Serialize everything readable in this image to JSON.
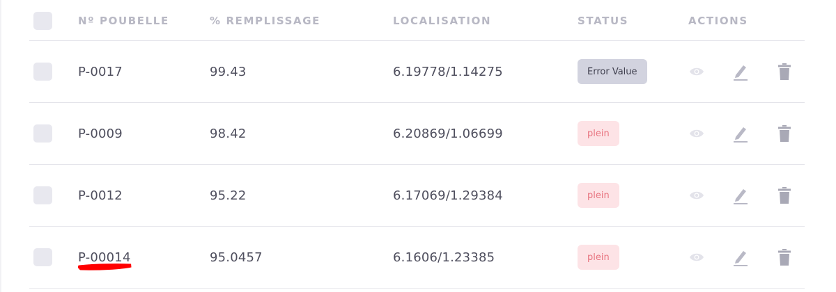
{
  "table": {
    "headers": {
      "id": "Nº POUBELLE",
      "fill": "% REMPLISSAGE",
      "location": "LOCALISATION",
      "status": "STATUS",
      "actions": "ACTIONS"
    },
    "rows": [
      {
        "id": "P-0017",
        "fill": "99.43",
        "location": "6.19778/1.14275",
        "status": "Error Value",
        "status_type": "error"
      },
      {
        "id": "P-0009",
        "fill": "98.42",
        "location": "6.20869/1.06699",
        "status": "plein",
        "status_type": "plein"
      },
      {
        "id": "P-0012",
        "fill": "95.22",
        "location": "6.17069/1.29384",
        "status": "plein",
        "status_type": "plein"
      },
      {
        "id": "P-00014",
        "fill": "95.0457",
        "location": "6.1606/1.23385",
        "status": "plein",
        "status_type": "plein"
      }
    ],
    "row_actions": [
      "eye-icon",
      "pencil-icon",
      "trash-icon"
    ]
  },
  "colors": {
    "header_text": "#b8b8c4",
    "error_badge_bg": "#d2d3df",
    "plein_badge_bg": "#fde3e6",
    "plein_badge_text": "#e8737f",
    "annotation_underline": "#ff0000"
  }
}
